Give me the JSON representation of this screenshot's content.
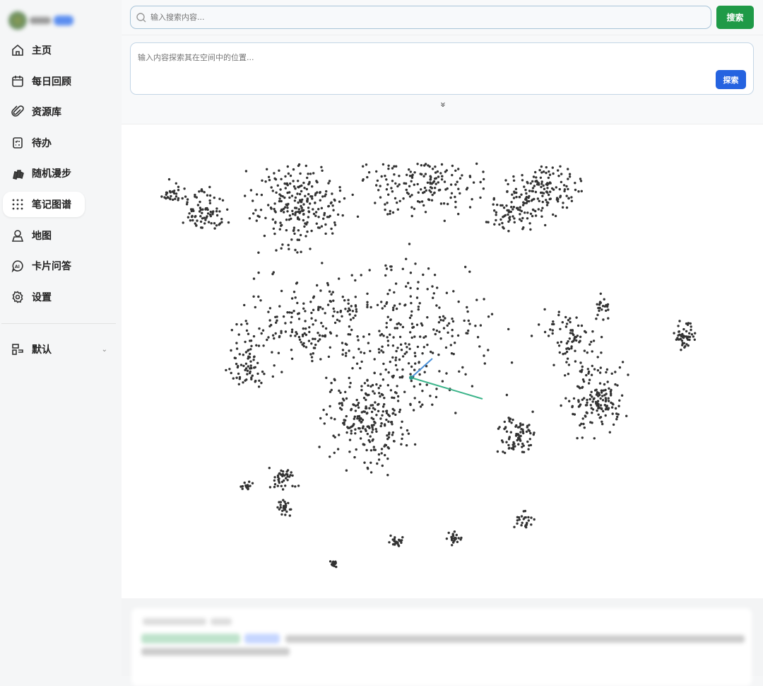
{
  "sidebar": {
    "items": [
      {
        "label": "主页",
        "icon": "home-icon"
      },
      {
        "label": "每日回顾",
        "icon": "calendar-icon"
      },
      {
        "label": "资源库",
        "icon": "paperclip-icon"
      },
      {
        "label": "待办",
        "icon": "todo-icon"
      },
      {
        "label": "随机漫步",
        "icon": "cards-icon"
      },
      {
        "label": "笔记图谱",
        "icon": "dots-grid-icon",
        "active": true
      },
      {
        "label": "地图",
        "icon": "map-pin-icon"
      },
      {
        "label": "卡片问答",
        "icon": "ai-chat-icon"
      },
      {
        "label": "设置",
        "icon": "gear-icon"
      }
    ],
    "workspace": {
      "label": "默认"
    }
  },
  "search": {
    "placeholder": "输入搜索内容...",
    "button": "搜索"
  },
  "explore": {
    "placeholder": "输入内容探索其在空间中的位置...",
    "button": "探索",
    "expand_icon": "»"
  },
  "colors": {
    "green": "#1f9a47",
    "blue": "#2563e0",
    "link_blue": "#4a90d9",
    "link_green": "#3cb48a"
  }
}
